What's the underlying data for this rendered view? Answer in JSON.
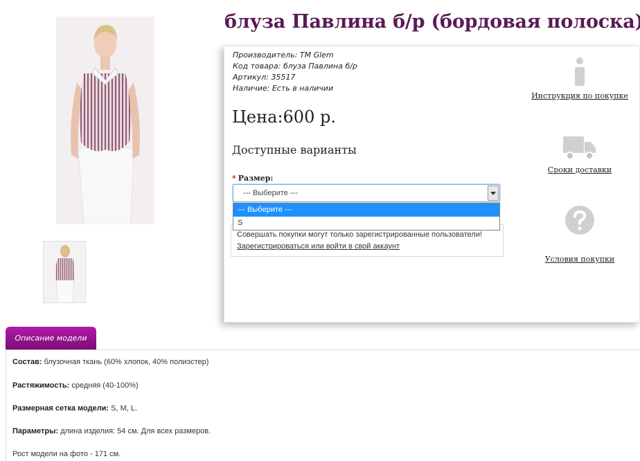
{
  "product": {
    "title": "блуза Павлина б/р (бордовая полоска)",
    "meta": [
      {
        "label": "Производитель:",
        "value": "TM Glem"
      },
      {
        "label": "Код товара:",
        "value": "блуза Павлина б/р"
      },
      {
        "label": "Артикул:",
        "value": "35517"
      },
      {
        "label": "Наличие:",
        "value": "Есть в наличии"
      }
    ],
    "price": "Цена:600 р.",
    "variants_heading": "Доступные варианты",
    "size": {
      "required_mark": "*",
      "label": "Размер:",
      "selected": "--- Выберите ---",
      "options": [
        "--- Выберите ---",
        "S"
      ]
    },
    "notice": {
      "text": "Совершать покупки могут только зарегистрированные пользователи!",
      "link": "Зарегистрироваться или войти в свой аккаунт"
    }
  },
  "side_links": [
    {
      "icon": "info-icon",
      "label": "Инструкция по покупке"
    },
    {
      "icon": "delivery-truck-icon",
      "label": "Сроки доставки"
    },
    {
      "icon": "question-icon",
      "label": "Условия покупки"
    }
  ],
  "tabs": [
    {
      "label": "Описание модели"
    }
  ],
  "description": [
    {
      "label": "Состав:",
      "text": " блузочная ткань (60% хлопок, 40% полиэстер)"
    },
    {
      "label": "Растяжимость:",
      "text": " средняя (40-100%)"
    },
    {
      "label": "Размерная сетка модели:",
      "text": " S, M, L."
    },
    {
      "label": "Параметры:",
      "text": " длина изделия: 54 см. Для всех размеров."
    },
    {
      "label": "",
      "text": "Рост модели на фото - 171 см."
    }
  ],
  "colors": {
    "title": "#5b1a55",
    "tab": "#9a1494",
    "selected_option": "#1e90ff",
    "required": "#e0161b"
  }
}
